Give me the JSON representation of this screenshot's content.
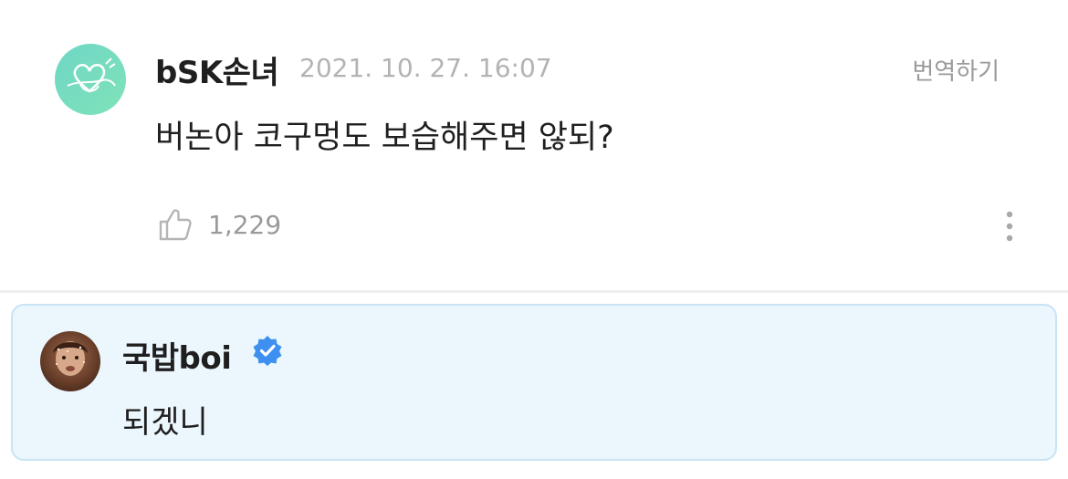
{
  "comment": {
    "author": "bSK손녀",
    "date": "2021. 10. 27. 16:07",
    "translate_label": "번역하기",
    "text": "버논아 코구멍도 보습해주면 않되?",
    "likes": "1,229"
  },
  "reply": {
    "author": "국밥boi",
    "text": "되겠니"
  },
  "icons": {
    "like": "thumbs-up-icon",
    "more": "more-vertical-icon",
    "verified": "verified-badge-icon"
  },
  "colors": {
    "reply_background": "#ecf6fd",
    "reply_border": "#c9e4f5",
    "verified_blue": "#3d8ff0",
    "avatar_green": "#7fe3b8"
  }
}
